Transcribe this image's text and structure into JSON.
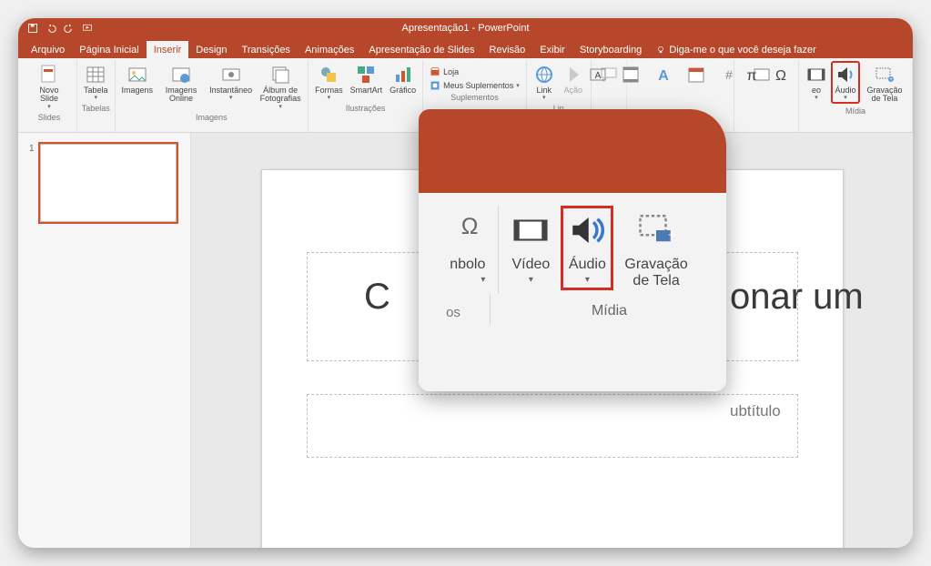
{
  "title": "Apresentação1 - PowerPoint",
  "tabs": {
    "arquivo": "Arquivo",
    "pagina": "Página Inicial",
    "inserir": "Inserir",
    "design": "Design",
    "transicoes": "Transições",
    "animacoes": "Animações",
    "apresentacao": "Apresentação de Slides",
    "revisao": "Revisão",
    "exibir": "Exibir",
    "storyboarding": "Storyboarding",
    "tellme": "Diga-me o que você deseja fazer"
  },
  "ribbon": {
    "slides": {
      "novo": "Novo\nSlide",
      "group": "Slides"
    },
    "tabelas": {
      "tabela": "Tabela",
      "group": "Tabelas"
    },
    "imagens": {
      "imagens": "Imagens",
      "online": "Imagens\nOnline",
      "instant": "Instantâneo",
      "album": "Álbum de\nFotografias",
      "group": "Imagens"
    },
    "ilustr": {
      "formas": "Formas",
      "smartart": "SmartArt",
      "grafico": "Gráfico",
      "group": "Ilustrações"
    },
    "supl": {
      "loja": "Loja",
      "meus": "Meus Suplementos",
      "group": "Suplementos"
    },
    "links": {
      "link": "Link",
      "acao": "Ação",
      "group": "Lin"
    },
    "texto": {
      "caixa": "",
      "cabecalho": "",
      "wordart": "",
      "data": "",
      "slide_num": "",
      "objeto": ""
    },
    "simbolos": {
      "equacao": "",
      "simbolo": ""
    },
    "midia": {
      "video": "Vídeo",
      "audio": "Áudio",
      "grav": "Gravação\nde Tela",
      "group": "Mídia"
    }
  },
  "thumb": {
    "num": "1"
  },
  "slide": {
    "title_hint_left": "C",
    "title_hint_right": "onar um",
    "subtitle_hint": "ubtítulo"
  },
  "callout": {
    "simbolo": "nbolo",
    "video": "Vídeo",
    "audio": "Áudio",
    "grav": "Gravação\nde Tela",
    "group": "Mídia",
    "os": "os"
  }
}
